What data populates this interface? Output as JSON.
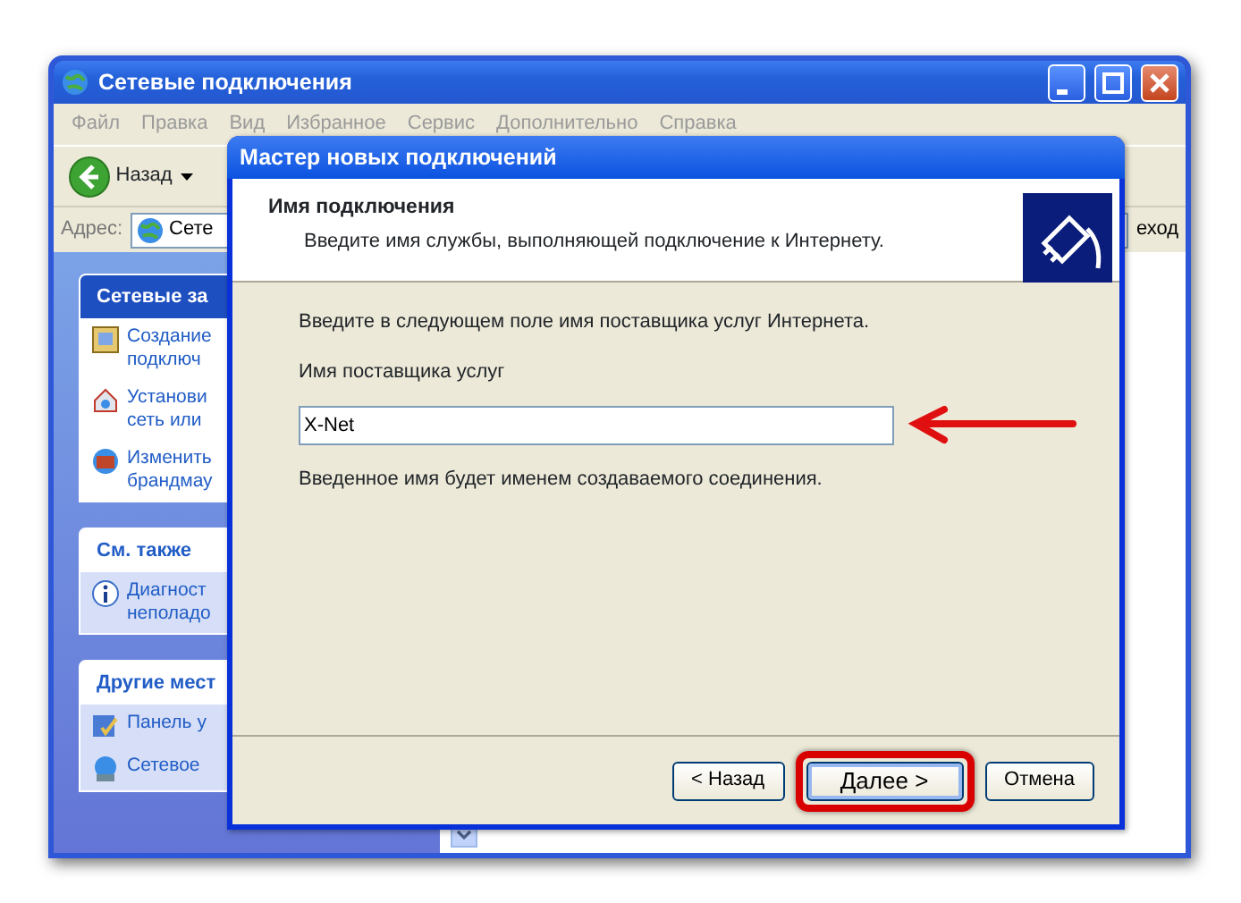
{
  "window": {
    "title": "Сетевые подключения",
    "menu": [
      "Файл",
      "Правка",
      "Вид",
      "Избранное",
      "Сервис",
      "Дополнительно",
      "Справка"
    ],
    "toolbar": {
      "back": "Назад"
    },
    "address": {
      "label": "Адрес:",
      "value": "Сете",
      "go": "еход"
    },
    "task_pane": [
      {
        "title": "Сетевые за",
        "kind": "special",
        "items": [
          {
            "lines": [
              "Создание",
              "подключ"
            ]
          },
          {
            "lines": [
              "Установи",
              "сеть или"
            ]
          },
          {
            "lines": [
              "Изменить",
              "брандмау"
            ]
          }
        ]
      },
      {
        "title": "См. также",
        "kind": "normal",
        "items": [
          {
            "lines": [
              "Диагност",
              "неполадо"
            ]
          }
        ]
      },
      {
        "title": "Другие мест",
        "kind": "normal",
        "items": [
          {
            "lines": [
              "Панель у"
            ]
          },
          {
            "lines": [
              "Сетевое"
            ]
          }
        ]
      }
    ]
  },
  "dialog": {
    "title": "Мастер новых подключений",
    "header_title": "Имя подключения",
    "header_subtitle": "Введите имя службы, выполняющей подключение к Интернету.",
    "intro": "Введите в следующем поле имя поставщика услуг Интернета.",
    "field": {
      "label": "Имя поставщика услуг",
      "value": "X-Net",
      "pointer_arrow": true
    },
    "note": "Введенное имя будет именем создаваемого соединения.",
    "buttons": [
      {
        "label": "< Назад",
        "highlighted": false,
        "default": false
      },
      {
        "label": "Далее >",
        "highlighted": true,
        "default": true
      },
      {
        "label": "Отмена",
        "highlighted": false,
        "default": false
      }
    ]
  }
}
